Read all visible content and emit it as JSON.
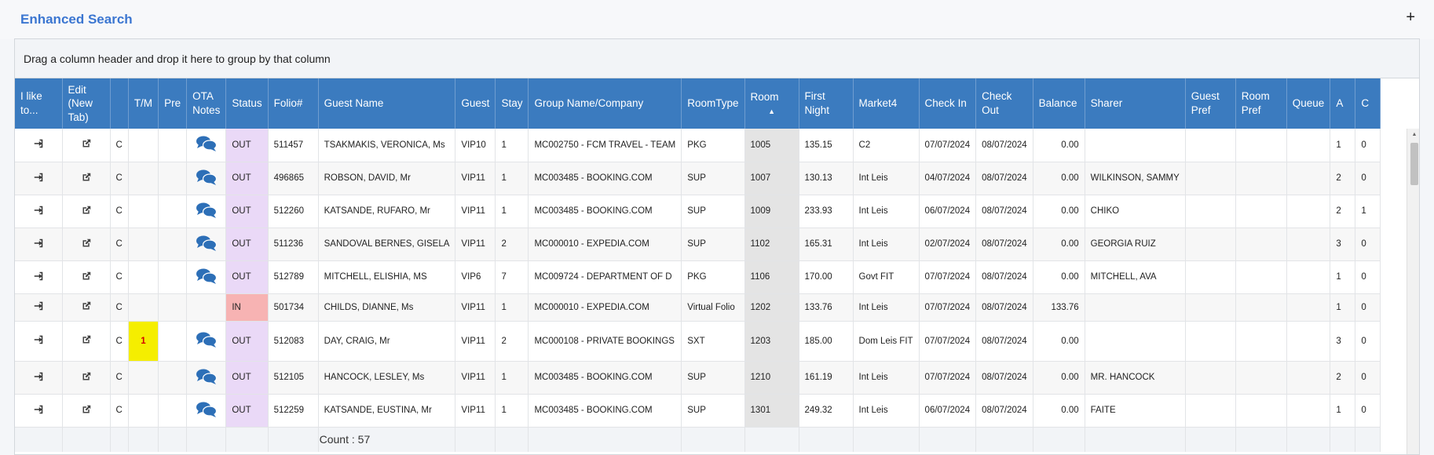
{
  "panel": {
    "title": "Enhanced Search",
    "plus": "+"
  },
  "group_hint": "Drag a column header and drop it here to group by that column",
  "columns": {
    "ilike": "I like to...",
    "edit": "Edit (New Tab)",
    "blank": "",
    "tm": "T/M",
    "pre": "Pre",
    "ota": "OTA Notes",
    "status": "Status",
    "folio": "Folio#",
    "guest_name": "Guest Name",
    "guest": "Guest",
    "stay": "Stay",
    "group": "Group Name/Company",
    "roomtype": "RoomType",
    "room": "Room",
    "first_night": "First Night",
    "market": "Market4",
    "check_in": "Check In",
    "check_out": "Check Out",
    "balance": "Balance",
    "sharer": "Sharer",
    "guest_pref": "Guest Pref",
    "room_pref": "Room Pref",
    "queue": "Queue",
    "a": "A",
    "c": "C"
  },
  "rows": [
    {
      "code": "C",
      "tm": "",
      "status": "OUT",
      "folio": "511457",
      "name": "TSAKMAKIS, VERONICA, Ms",
      "guest": "VIP10",
      "stay": "1",
      "group": "MC002750 - FCM TRAVEL - TEAM",
      "roomtype": "PKG",
      "room": "1005",
      "first_night": "135.15",
      "market": "C2",
      "check_in": "07/07/2024",
      "check_out": "08/07/2024",
      "balance": "0.00",
      "sharer": "",
      "a": "1",
      "c": "0",
      "ota": true
    },
    {
      "code": "C",
      "tm": "",
      "status": "OUT",
      "folio": "496865",
      "name": "ROBSON, DAVID, Mr",
      "guest": "VIP11",
      "stay": "1",
      "group": "MC003485 - BOOKING.COM",
      "roomtype": "SUP",
      "room": "1007",
      "first_night": "130.13",
      "market": "Int Leis",
      "check_in": "04/07/2024",
      "check_out": "08/07/2024",
      "balance": "0.00",
      "sharer": "WILKINSON, SAMMY",
      "a": "2",
      "c": "0",
      "ota": true
    },
    {
      "code": "C",
      "tm": "",
      "status": "OUT",
      "folio": "512260",
      "name": "KATSANDE, RUFARO, Mr",
      "guest": "VIP11",
      "stay": "1",
      "group": "MC003485 - BOOKING.COM",
      "roomtype": "SUP",
      "room": "1009",
      "first_night": "233.93",
      "market": "Int Leis",
      "check_in": "06/07/2024",
      "check_out": "08/07/2024",
      "balance": "0.00",
      "sharer": "CHIKO",
      "a": "2",
      "c": "1",
      "ota": true
    },
    {
      "code": "C",
      "tm": "",
      "status": "OUT",
      "folio": "511236",
      "name": "SANDOVAL BERNES, GISELA",
      "guest": "VIP11",
      "stay": "2",
      "group": "MC000010 - EXPEDIA.COM",
      "roomtype": "SUP",
      "room": "1102",
      "first_night": "165.31",
      "market": "Int Leis",
      "check_in": "02/07/2024",
      "check_out": "08/07/2024",
      "balance": "0.00",
      "sharer": "GEORGIA RUIZ",
      "a": "3",
      "c": "0",
      "ota": true
    },
    {
      "code": "C",
      "tm": "",
      "status": "OUT",
      "folio": "512789",
      "name": "MITCHELL, ELISHIA, MS",
      "guest": "VIP6",
      "stay": "7",
      "group": "MC009724 - DEPARTMENT OF D",
      "roomtype": "PKG",
      "room": "1106",
      "first_night": "170.00",
      "market": "Govt FIT",
      "check_in": "07/07/2024",
      "check_out": "08/07/2024",
      "balance": "0.00",
      "sharer": "MITCHELL, AVA",
      "a": "1",
      "c": "0",
      "ota": true
    },
    {
      "code": "C",
      "tm": "",
      "status": "IN",
      "folio": "501734",
      "name": "CHILDS, DIANNE, Ms",
      "guest": "VIP11",
      "stay": "1",
      "group": "MC000010 - EXPEDIA.COM",
      "roomtype": "Virtual Folio",
      "room": "1202",
      "first_night": "133.76",
      "market": "Int Leis",
      "check_in": "07/07/2024",
      "check_out": "08/07/2024",
      "balance": "133.76",
      "sharer": "",
      "a": "1",
      "c": "0",
      "ota": false
    },
    {
      "code": "C",
      "tm": "1",
      "status": "OUT",
      "folio": "512083",
      "name": "DAY, CRAIG, Mr",
      "guest": "VIP11",
      "stay": "2",
      "group": "MC000108 - PRIVATE BOOKINGS",
      "roomtype": "SXT",
      "room": "1203",
      "first_night": "185.00",
      "market": "Dom Leis FIT",
      "check_in": "07/07/2024",
      "check_out": "08/07/2024",
      "balance": "0.00",
      "sharer": "",
      "a": "3",
      "c": "0",
      "ota": true
    },
    {
      "code": "C",
      "tm": "",
      "status": "OUT",
      "folio": "512105",
      "name": "HANCOCK, LESLEY, Ms",
      "guest": "VIP11",
      "stay": "1",
      "group": "MC003485 - BOOKING.COM",
      "roomtype": "SUP",
      "room": "1210",
      "first_night": "161.19",
      "market": "Int Leis",
      "check_in": "07/07/2024",
      "check_out": "08/07/2024",
      "balance": "0.00",
      "sharer": "MR. HANCOCK",
      "a": "2",
      "c": "0",
      "ota": true
    },
    {
      "code": "C",
      "tm": "",
      "status": "OUT",
      "folio": "512259",
      "name": "KATSANDE, EUSTINA, Mr",
      "guest": "VIP11",
      "stay": "1",
      "group": "MC003485 - BOOKING.COM",
      "roomtype": "SUP",
      "room": "1301",
      "first_night": "249.32",
      "market": "Int Leis",
      "check_in": "06/07/2024",
      "check_out": "08/07/2024",
      "balance": "0.00",
      "sharer": "FAITE",
      "a": "1",
      "c": "0",
      "ota": true
    }
  ],
  "footer": {
    "count": "Count : 57"
  },
  "icons": {
    "action": "sign-in-icon",
    "edit": "external-link-icon",
    "ota": "comments-icon"
  },
  "colors": {
    "header": "#3b7bbf",
    "title": "#3b76d1",
    "status_out": "#ead9f7",
    "status_in": "#f7b3b3",
    "tm_flag": "#f5ee00"
  }
}
